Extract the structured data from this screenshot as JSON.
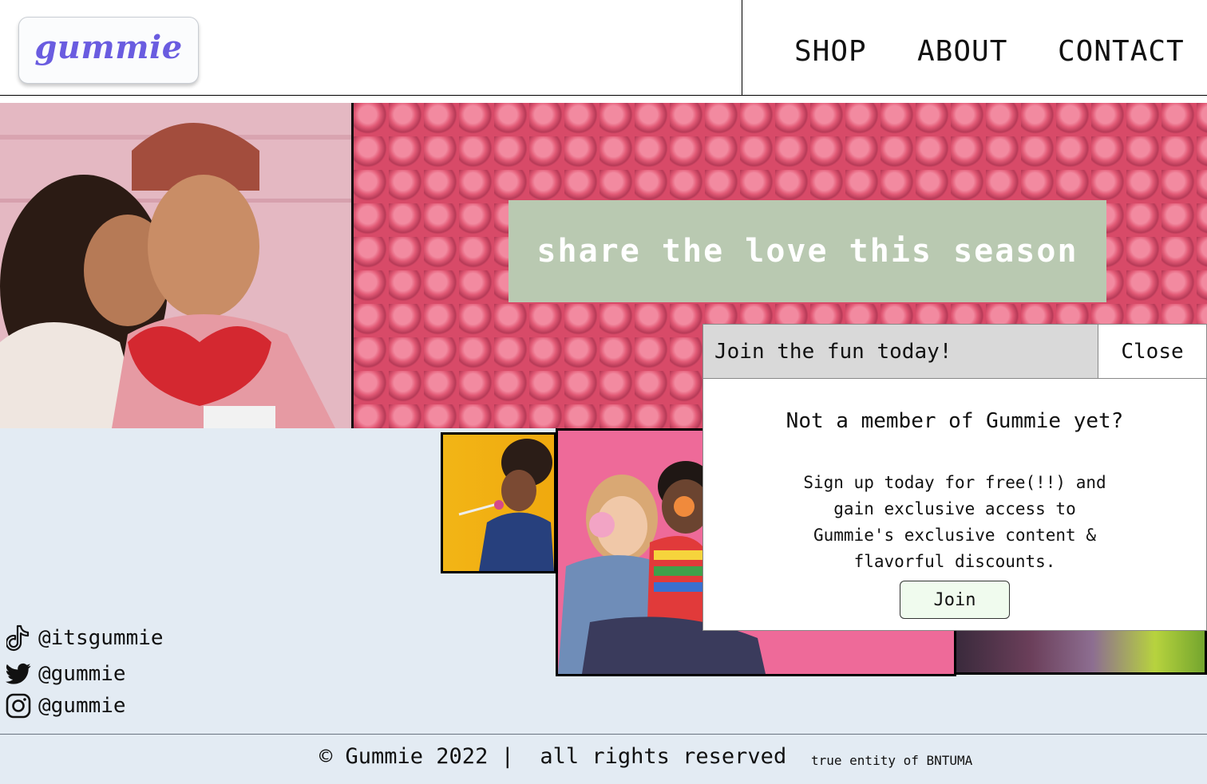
{
  "header": {
    "logo": "gummie",
    "nav": [
      "SHOP",
      "ABOUT",
      "CONTACT"
    ]
  },
  "hero": {
    "banner_text": "share the love this season"
  },
  "modal": {
    "header_title": "Join the fun today!",
    "close_label": "Close",
    "title": "Not a member of Gummie yet?",
    "body": "Sign up today for free(!!) and gain exclusive access to Gummie's exclusive content & flavorful discounts.",
    "join_label": "Join"
  },
  "socials": [
    {
      "icon": "tiktok-icon",
      "handle": "@itsgummie"
    },
    {
      "icon": "twitter-icon",
      "handle": "@gummie"
    },
    {
      "icon": "instagram-icon",
      "handle": "@gummie"
    }
  ],
  "footer": {
    "copyright": "© Gummie 2022 |  all rights reserved",
    "entity": "true entity of BNTUMA"
  },
  "colors": {
    "logo": "#6a5ce0",
    "banner": "#b9c9b1",
    "page_bg": "#e3ebf3",
    "join_button_bg": "#f0fbee"
  }
}
